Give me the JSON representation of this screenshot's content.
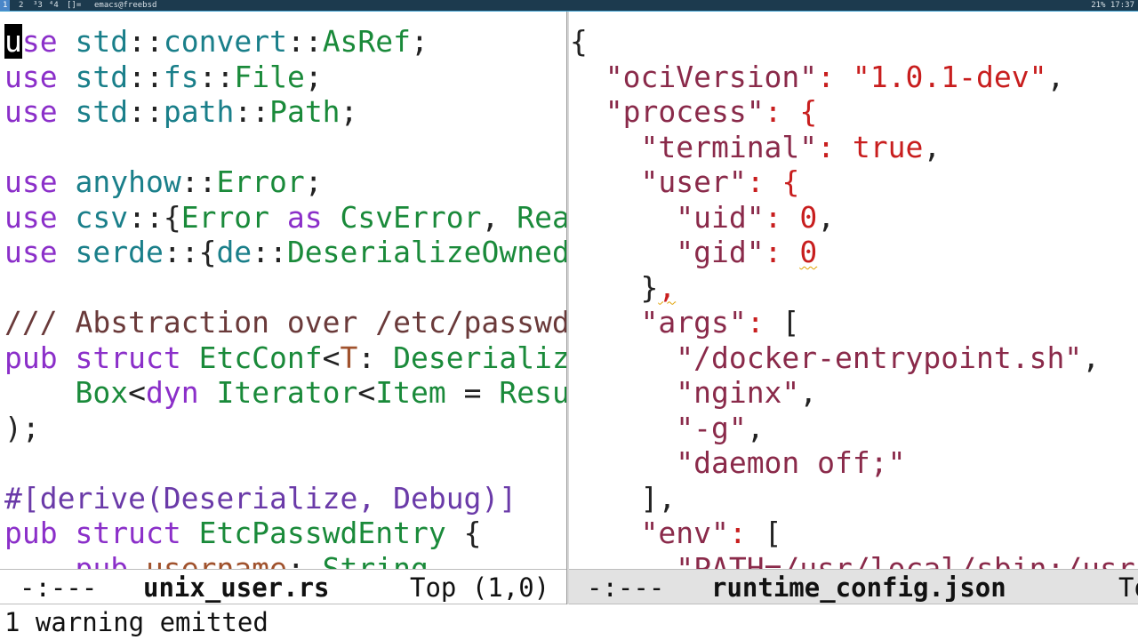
{
  "topbar": {
    "workspaces": [
      "1",
      "2",
      "³3",
      "⁴4",
      "[]="
    ],
    "window_title": "emacs@freebsd",
    "status": "21% 17:37"
  },
  "left_pane": {
    "lines": [
      [
        [
          "cursor",
          "u"
        ],
        [
          "kw",
          "se"
        ],
        [
          "pn",
          " "
        ],
        [
          "ns",
          "std"
        ],
        [
          "pn",
          "::"
        ],
        [
          "ns",
          "convert"
        ],
        [
          "pn",
          "::"
        ],
        [
          "ty",
          "AsRef"
        ],
        [
          "pn",
          ";"
        ]
      ],
      [
        [
          "kw",
          "use"
        ],
        [
          "pn",
          " "
        ],
        [
          "ns",
          "std"
        ],
        [
          "pn",
          "::"
        ],
        [
          "ns",
          "fs"
        ],
        [
          "pn",
          "::"
        ],
        [
          "ty",
          "File"
        ],
        [
          "pn",
          ";"
        ]
      ],
      [
        [
          "kw",
          "use"
        ],
        [
          "pn",
          " "
        ],
        [
          "ns",
          "std"
        ],
        [
          "pn",
          "::"
        ],
        [
          "ns",
          "path"
        ],
        [
          "pn",
          "::"
        ],
        [
          "ty",
          "Path"
        ],
        [
          "pn",
          ";"
        ]
      ],
      [],
      [
        [
          "kw",
          "use"
        ],
        [
          "pn",
          " "
        ],
        [
          "ns",
          "anyhow"
        ],
        [
          "pn",
          "::"
        ],
        [
          "ty",
          "Error"
        ],
        [
          "pn",
          ";"
        ]
      ],
      [
        [
          "kw",
          "use"
        ],
        [
          "pn",
          " "
        ],
        [
          "ns",
          "csv"
        ],
        [
          "pn",
          "::{"
        ],
        [
          "ty",
          "Error"
        ],
        [
          "pn",
          " "
        ],
        [
          "kw",
          "as"
        ],
        [
          "pn",
          " "
        ],
        [
          "ty",
          "CsvError"
        ],
        [
          "pn",
          ", "
        ],
        [
          "ty",
          "Rea"
        ]
      ],
      [
        [
          "kw",
          "use"
        ],
        [
          "pn",
          " "
        ],
        [
          "ns",
          "serde"
        ],
        [
          "pn",
          "::{"
        ],
        [
          "ns",
          "de"
        ],
        [
          "pn",
          "::"
        ],
        [
          "ty",
          "DeserializeOwned"
        ]
      ],
      [],
      [
        [
          "cm",
          "/// Abstraction over /etc/passwd"
        ]
      ],
      [
        [
          "kw",
          "pub"
        ],
        [
          "pn",
          " "
        ],
        [
          "kw",
          "struct"
        ],
        [
          "pn",
          " "
        ],
        [
          "ty",
          "EtcConf"
        ],
        [
          "pn",
          "<"
        ],
        [
          "va",
          "T"
        ],
        [
          "pn",
          ": "
        ],
        [
          "ty",
          "Deserializ"
        ]
      ],
      [
        [
          "pn",
          "    "
        ],
        [
          "ty",
          "Box"
        ],
        [
          "pn",
          "<"
        ],
        [
          "kw",
          "dyn"
        ],
        [
          "pn",
          " "
        ],
        [
          "ty",
          "Iterator"
        ],
        [
          "pn",
          "<"
        ],
        [
          "ty",
          "Item"
        ],
        [
          "pn",
          " = "
        ],
        [
          "ty",
          "Resu"
        ]
      ],
      [
        [
          "pn",
          ");"
        ]
      ],
      [],
      [
        [
          "at",
          "#[derive(Deserialize, Debug)]"
        ]
      ],
      [
        [
          "kw",
          "pub"
        ],
        [
          "pn",
          " "
        ],
        [
          "kw",
          "struct"
        ],
        [
          "pn",
          " "
        ],
        [
          "ty",
          "EtcPasswdEntry"
        ],
        [
          "pn",
          " {"
        ]
      ],
      [
        [
          "pn",
          "    "
        ],
        [
          "kw",
          "pub"
        ],
        [
          "pn",
          " "
        ],
        [
          "va",
          "username"
        ],
        [
          "pn",
          ": "
        ],
        [
          "ty",
          "String"
        ],
        [
          "pn",
          ","
        ]
      ]
    ]
  },
  "right_pane": {
    "lines": [
      [
        [
          "pn",
          "{"
        ]
      ],
      [
        [
          "pn",
          "  "
        ],
        [
          "jk",
          "\"ociVersion\""
        ],
        [
          "jc",
          ":"
        ],
        [
          "pn",
          " "
        ],
        [
          "js",
          "\"1.0.1-dev\""
        ],
        [
          "pn",
          ","
        ]
      ],
      [
        [
          "pn",
          "  "
        ],
        [
          "jk",
          "\"process\""
        ],
        [
          "jc",
          ":"
        ],
        [
          "pn",
          " "
        ],
        [
          "js",
          "{"
        ]
      ],
      [
        [
          "pn",
          "    "
        ],
        [
          "jk",
          "\"terminal\""
        ],
        [
          "jc",
          ":"
        ],
        [
          "pn",
          " "
        ],
        [
          "js",
          "true"
        ],
        [
          "pn",
          ","
        ]
      ],
      [
        [
          "pn",
          "    "
        ],
        [
          "jk",
          "\"user\""
        ],
        [
          "jc",
          ":"
        ],
        [
          "pn",
          " "
        ],
        [
          "js",
          "{"
        ]
      ],
      [
        [
          "pn",
          "      "
        ],
        [
          "jk",
          "\"uid\""
        ],
        [
          "jc",
          ":"
        ],
        [
          "pn",
          " "
        ],
        [
          "js",
          "0"
        ],
        [
          "pn",
          ","
        ]
      ],
      [
        [
          "pn",
          "      "
        ],
        [
          "jk",
          "\"gid\""
        ],
        [
          "jc",
          ":"
        ],
        [
          "pn",
          " "
        ],
        [
          "wavyjs",
          "0"
        ]
      ],
      [
        [
          "pn",
          "    }"
        ],
        [
          "wavyjs",
          ","
        ]
      ],
      [
        [
          "pn",
          "    "
        ],
        [
          "jk",
          "\"args\""
        ],
        [
          "jc",
          ":"
        ],
        [
          "pn",
          " ["
        ]
      ],
      [
        [
          "pn",
          "      "
        ],
        [
          "jk",
          "\"/docker-entrypoint.sh\""
        ],
        [
          "pn",
          ","
        ]
      ],
      [
        [
          "pn",
          "      "
        ],
        [
          "jk",
          "\"nginx\""
        ],
        [
          "pn",
          ","
        ]
      ],
      [
        [
          "pn",
          "      "
        ],
        [
          "jk",
          "\"-g\""
        ],
        [
          "pn",
          ","
        ]
      ],
      [
        [
          "pn",
          "      "
        ],
        [
          "jk",
          "\"daemon off;\""
        ]
      ],
      [
        [
          "pn",
          "    ],"
        ]
      ],
      [
        [
          "pn",
          "    "
        ],
        [
          "jk",
          "\"env\""
        ],
        [
          "jc",
          ":"
        ],
        [
          "pn",
          " ["
        ]
      ],
      [
        [
          "pn",
          "      "
        ],
        [
          "jk",
          "\"PATH=/usr/local/sbin:/usr"
        ]
      ]
    ]
  },
  "modeline_left": {
    "flags": "-:---",
    "buffer_name": "unix_user.rs",
    "position": "Top (1,0)"
  },
  "modeline_right": {
    "flags": "-:---",
    "buffer_name": "runtime_config.json",
    "position": "To"
  },
  "echo_area": {
    "message": "1 warning emitted"
  }
}
